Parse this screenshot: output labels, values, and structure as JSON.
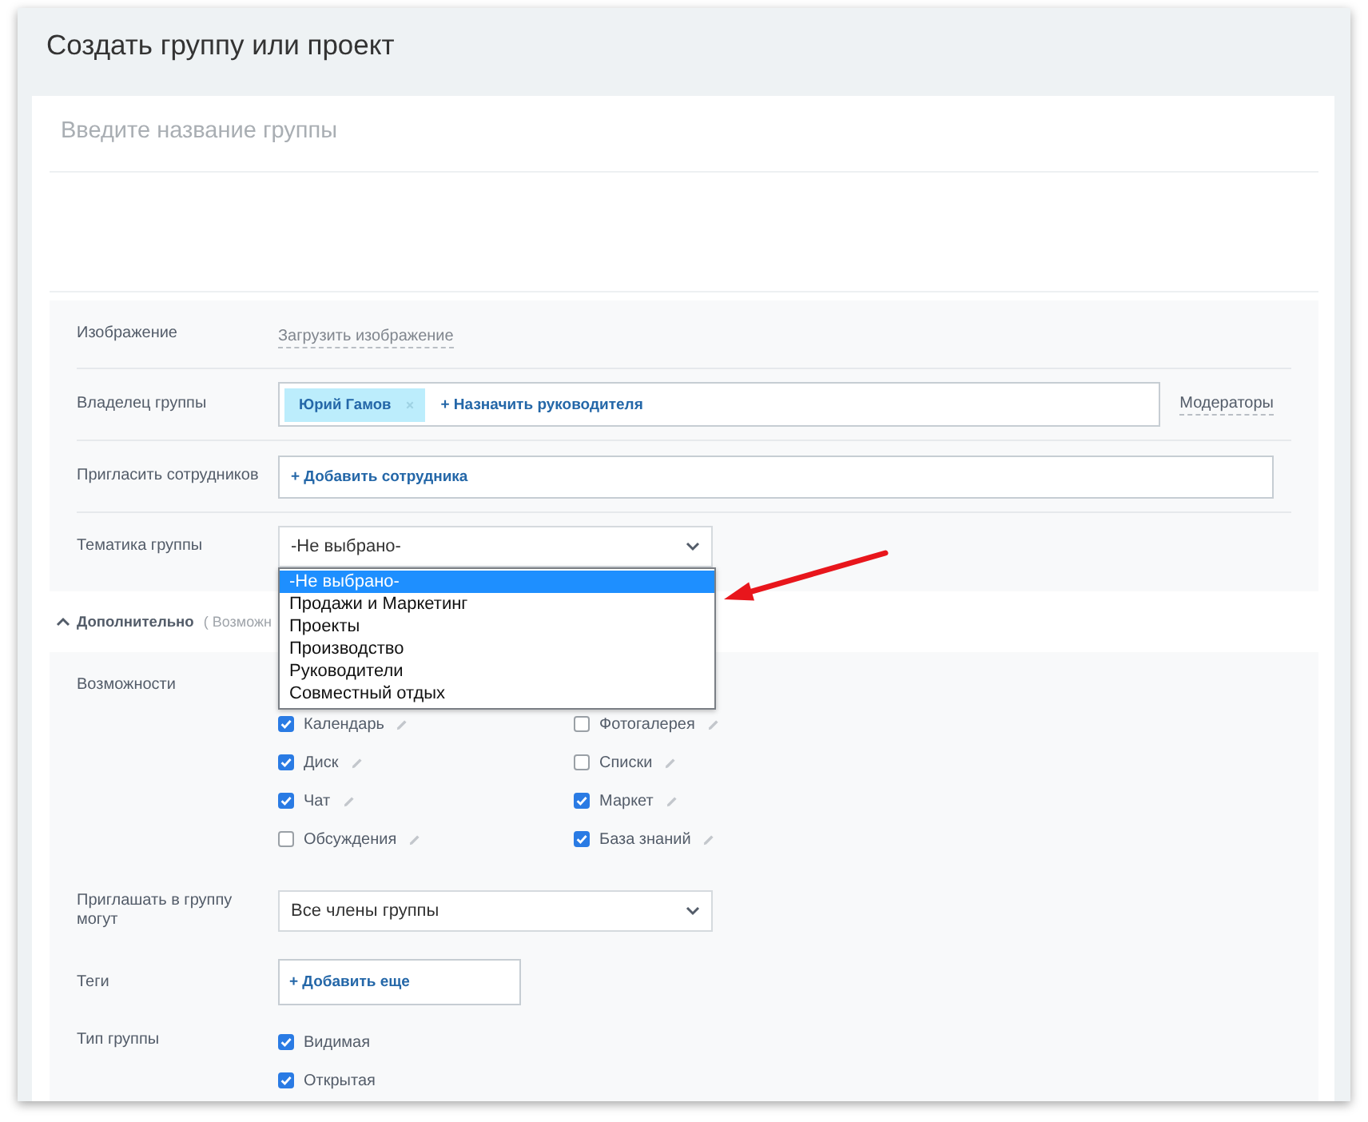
{
  "window": {
    "title": "Создать группу или проект"
  },
  "name_field": {
    "placeholder": "Введите название группы"
  },
  "main_settings": [
    {
      "kind": "upload",
      "label": "Изображение",
      "link": "Загрузить изображение"
    },
    {
      "kind": "owner",
      "label": "Владелец группы",
      "tags": [
        {
          "name": "Юрий Гамов"
        }
      ],
      "add_label": "+ Назначить руководителя",
      "side_link": "Модераторы"
    },
    {
      "kind": "members",
      "label": "Пригласить сотрудников",
      "add_label": "+ Добавить сотрудника"
    },
    {
      "kind": "select",
      "label": "Тематика группы",
      "value": "-Не выбрано-",
      "expanded": true,
      "options": [
        {
          "label": "-Не выбрано-",
          "selected": true
        },
        {
          "label": "Продажи и Маркетинг",
          "selected": false
        },
        {
          "label": "Проекты",
          "selected": false
        },
        {
          "label": "Производство",
          "selected": false
        },
        {
          "label": "Руководители",
          "selected": false
        },
        {
          "label": "Совместный отдых",
          "selected": false
        }
      ]
    }
  ],
  "advanced": {
    "title": "Дополнительно",
    "hint": "( Возможн",
    "expanded": true
  },
  "features": {
    "label": "Возможности",
    "items": [
      {
        "label": "Календарь",
        "checked": true
      },
      {
        "label": "Фотогалерея",
        "checked": false
      },
      {
        "label": "Диск",
        "checked": true
      },
      {
        "label": "Списки",
        "checked": false
      },
      {
        "label": "Чат",
        "checked": true
      },
      {
        "label": "Маркет",
        "checked": true
      },
      {
        "label": "Обсуждения",
        "checked": false
      },
      {
        "label": "База знаний",
        "checked": true
      }
    ]
  },
  "invite": {
    "label": "Приглашать в группу могут",
    "value": "Все члены группы"
  },
  "tags": {
    "label": "Теги",
    "add_label": "+ Добавить еще"
  },
  "group_type": {
    "label": "Тип группы",
    "options": [
      {
        "label": "Видимая",
        "checked": true
      },
      {
        "label": "Открытая",
        "checked": true
      }
    ]
  }
}
